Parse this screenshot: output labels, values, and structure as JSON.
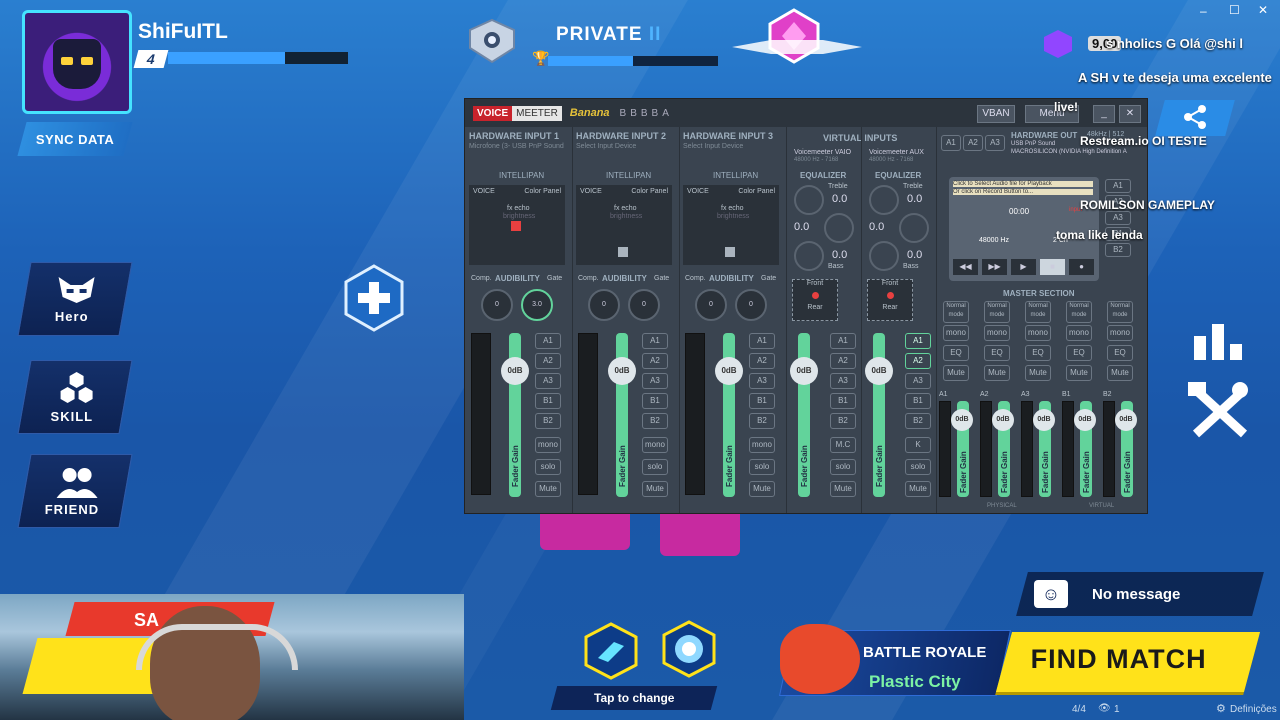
{
  "player": {
    "name": "ShiFuITL",
    "level": "4",
    "xp_fraction": 0.65
  },
  "rank": {
    "title": "PRIVATE",
    "tier": "II",
    "progress_fraction": 0.5
  },
  "sync_label": "SYNC DATA",
  "side_menu": [
    {
      "label": "Hero",
      "icon": "hero-mask-icon"
    },
    {
      "label": "SKILL",
      "icon": "skill-hexagons-icon"
    },
    {
      "label": "FRIEND",
      "icon": "friends-icon"
    }
  ],
  "window_controls": {
    "minimize": "–",
    "maximize": "☐",
    "close": "✕"
  },
  "stream_overlay": {
    "coins": "9,00",
    "chat": [
      {
        "text": "s    nholics G Olá @shi    l"
      },
      {
        "text": "A SH v te deseja uma excelente"
      },
      {
        "text": "live!"
      },
      {
        "text": "Restream.io  OI TESTE"
      },
      {
        "text": "ROMILSON GAMEPLAY"
      },
      {
        "text": "toma like lenda"
      }
    ]
  },
  "voicemeeter": {
    "logo_voice": "VOICE",
    "logo_meeter": "MEETER",
    "logo_banana": "Banana",
    "brand_letters": "BBBBA",
    "vban": "VBAN",
    "menu": "Menu",
    "strips": [
      {
        "title": "HARDWARE INPUT 1",
        "device": "Microfone (3- USB PnP Sound",
        "section": "INTELLIPAN",
        "voice": "VOICE",
        "color_panel": "Color Panel",
        "fx": "fx echo",
        "brightness": "brightness",
        "comp": "Comp.",
        "audibility": "AUDIBILITY",
        "gate": "Gate",
        "knob1": "0",
        "knob2": "3.0",
        "fader_value": "0dB",
        "fader_label": "Fader Gain",
        "busses": [
          "A1",
          "A2",
          "A3",
          "B1",
          "B2"
        ],
        "mono": "mono",
        "solo": "solo",
        "mute": "Mute"
      },
      {
        "title": "HARDWARE INPUT 2",
        "device": "Select Input Device",
        "section": "INTELLIPAN",
        "voice": "VOICE",
        "color_panel": "Color Panel",
        "fx": "fx echo",
        "brightness": "brightness",
        "comp": "Comp.",
        "audibility": "AUDIBILITY",
        "gate": "Gate",
        "knob1": "0",
        "knob2": "0",
        "fader_value": "0dB",
        "fader_label": "Fader Gain",
        "busses": [
          "A1",
          "A2",
          "A3",
          "B1",
          "B2"
        ],
        "mono": "mono",
        "solo": "solo",
        "mute": "Mute"
      },
      {
        "title": "HARDWARE INPUT 3",
        "device": "Select Input Device",
        "section": "INTELLIPAN",
        "voice": "VOICE",
        "color_panel": "Color Panel",
        "fx": "fx echo",
        "brightness": "brightness",
        "comp": "Comp.",
        "audibility": "AUDIBILITY",
        "gate": "Gate",
        "knob1": "0",
        "knob2": "0",
        "fader_value": "0dB",
        "fader_label": "Fader Gain",
        "busses": [
          "A1",
          "A2",
          "A3",
          "B1",
          "B2"
        ],
        "mono": "mono",
        "solo": "solo",
        "mute": "Mute"
      }
    ],
    "virtual": {
      "title": "VIRTUAL INPUTS",
      "inputs": [
        {
          "name": "Voicemeeter VAIO",
          "rate": "48000 Hz - 7168",
          "eq": "EQUALIZER",
          "treble_label": "Treble",
          "treble": "0.0",
          "mid": "0.0",
          "bass": "0.0",
          "bass_label": "Bass",
          "front": "Front",
          "rear": "Rear",
          "fader_value": "0dB",
          "fader_label": "Fader Gain",
          "busses": [
            "A1",
            "A2",
            "A3",
            "B1",
            "B2"
          ],
          "mc": "M.C",
          "solo": "solo",
          "mute": "Mute"
        },
        {
          "name": "Voicemeeter AUX",
          "rate": "48000 Hz - 7168",
          "eq": "EQUALIZER",
          "treble_label": "Treble",
          "treble": "0.0",
          "mid": "0.0",
          "bass": "0.0",
          "bass_label": "Bass",
          "front": "Front",
          "rear": "Rear",
          "fader_value": "0dB",
          "fader_label": "Fader Gain",
          "busses": [
            "A1",
            "A2",
            "A3",
            "B1",
            "B2"
          ],
          "mc": "K",
          "solo": "solo",
          "mute": "Mute"
        }
      ]
    },
    "hw_out": {
      "title": "HARDWARE OUT",
      "detail": "48kHz | 512",
      "a1": "A1",
      "a2": "A2",
      "a3": "A3",
      "line1": "USB PnP Sound",
      "line2": "MACROSILICON (NVIDIA High Definition A"
    },
    "cassette": {
      "hint1": "Click to Select Audio file for Playback",
      "hint2": "Or click on Record Button to...",
      "time": "00:00",
      "rate": "48000 Hz",
      "ch": "2 Ch",
      "input": "input"
    },
    "cassette_busses": [
      "A1",
      "A2",
      "A3",
      "B1",
      "B2"
    ],
    "master": {
      "title": "MASTER SECTION",
      "buses": [
        {
          "label": "A1",
          "mode": "Normal mode",
          "mono": "mono",
          "eq": "EQ",
          "mute": "Mute",
          "fader": "0dB"
        },
        {
          "label": "A2",
          "mode": "Normal mode",
          "mono": "mono",
          "eq": "EQ",
          "mute": "Mute",
          "fader": "0dB"
        },
        {
          "label": "A3",
          "mode": "Normal mode",
          "mono": "mono",
          "eq": "EQ",
          "mute": "Mute",
          "fader": "0dB"
        },
        {
          "label": "B1",
          "mode": "Normal mode",
          "mono": "mono",
          "eq": "EQ",
          "mute": "Mute",
          "fader": "0dB"
        },
        {
          "label": "B2",
          "mode": "Normal mode",
          "mono": "mono",
          "eq": "EQ",
          "mute": "Mute",
          "fader": "0dB"
        }
      ],
      "fader_label": "Fader Gain",
      "physical": "PHYSICAL",
      "virtual": "VIRTUAL"
    }
  },
  "bottom": {
    "no_message": "No message",
    "tap_to_change": "Tap to change",
    "mode_title": "BATTLE ROYALE",
    "mode_map": "Plastic City",
    "find_match": "FIND MATCH",
    "page": "4/4",
    "viewers": "1",
    "settings": "Definições",
    "webcam_banner": "SA"
  },
  "colors": {
    "accent": "#2a8ce6",
    "find": "#ffe21a",
    "fader": "#62d39b",
    "map": "#7cf2a4"
  }
}
